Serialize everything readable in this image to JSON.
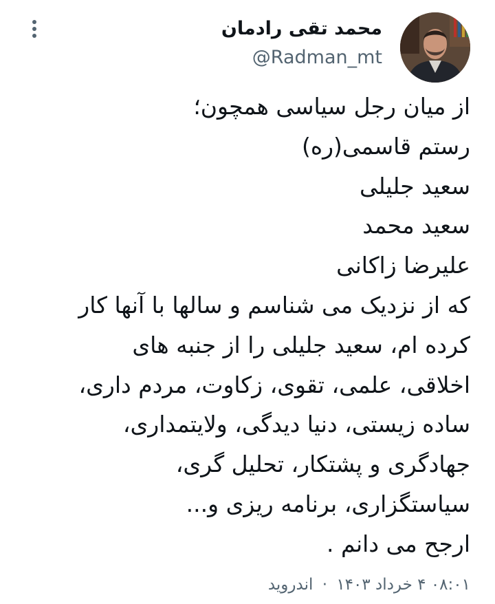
{
  "tweet": {
    "author": {
      "display_name": "محمد تقی رادمان",
      "handle": "@Radman_mt"
    },
    "lines": [
      "از میان رجل سیاسی همچون؛",
      "رستم قاسمی(ره)",
      "سعید جلیلی",
      "سعید محمد",
      "علیرضا زاکانی",
      "که از نزدیک می شناسم و سالها با آنها کار",
      "کرده ام، سعید جلیلی را از جنبه های",
      "اخلاقی، علمی، تقوی، زکاوت، مردم داری،",
      "ساده زیستی، دنیا دیدگی، ولایتمداری،",
      "جهادگری و پشتکار، تحلیل گری،",
      "سیاستگزاری، برنامه ریزی و...",
      " ارجح می دانم ."
    ],
    "meta": {
      "time": "۰۸:۰۱",
      "date": "۴ خرداد ۱۴۰۳",
      "separator": "·",
      "source": "اندروید"
    }
  },
  "icons": {
    "more": "more-vertical-icon"
  }
}
